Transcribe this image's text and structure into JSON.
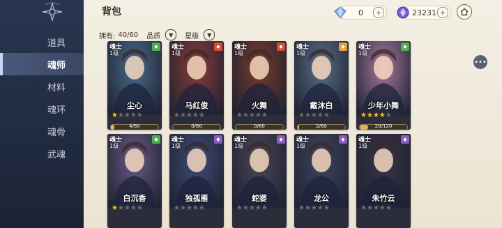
{
  "sidebar": {
    "items": [
      {
        "label": "道具",
        "active": false
      },
      {
        "label": "魂师",
        "active": true
      },
      {
        "label": "材料",
        "active": false
      },
      {
        "label": "魂环",
        "active": false
      },
      {
        "label": "魂骨",
        "active": false
      },
      {
        "label": "武魂",
        "active": false
      }
    ]
  },
  "header": {
    "title": "背包",
    "currency1": {
      "icon": "diamond-icon",
      "value": "0"
    },
    "currency2": {
      "icon": "purple-crystal-icon",
      "value": "23231"
    },
    "home_icon": "home-icon"
  },
  "filters": {
    "owned_label": "拥有:",
    "owned_value": "40/60",
    "quality_label": "品质",
    "star_label": "星级"
  },
  "chat_icon": "chat-bubble-icon",
  "cards": [
    {
      "type": "魂士",
      "level": "1级",
      "name": "尘心",
      "stars": 1,
      "max_stars": 5,
      "progress": "4/60",
      "progress_frac": 0.07,
      "element": "tree",
      "element_color": "#4caf50",
      "bg": "#4a6b8c"
    },
    {
      "type": "魂士",
      "level": "1级",
      "name": "马红俊",
      "stars": 0,
      "max_stars": 5,
      "progress": "0/60",
      "progress_frac": 0.0,
      "element": "fire",
      "element_color": "#d94a3a",
      "bg": "#8a3b3b"
    },
    {
      "type": "魂士",
      "level": "1级",
      "name": "火舞",
      "stars": 0,
      "max_stars": 5,
      "progress": "0/60",
      "progress_frac": 0.0,
      "element": "fire",
      "element_color": "#d94a3a",
      "bg": "#7a3a2c"
    },
    {
      "type": "魂士",
      "level": "1级",
      "name": "戴沐白",
      "stars": 0,
      "max_stars": 5,
      "progress": "2/60",
      "progress_frac": 0.03,
      "element": "light",
      "element_color": "#e2a23a",
      "bg": "#5a6f8a"
    },
    {
      "type": "魂士",
      "level": "1级",
      "name": "少年小舞",
      "stars": 4,
      "max_stars": 5,
      "progress": "20/120",
      "progress_frac": 0.17,
      "element": "tree",
      "element_color": "#4caf50",
      "bg": "#a87aa0"
    },
    {
      "type": "魂士",
      "level": "1级",
      "name": "白沉香",
      "stars": 1,
      "max_stars": 5,
      "progress": "",
      "progress_frac": 0,
      "element": "wind",
      "element_color": "#4caf50",
      "bg": "#6b5a8a"
    },
    {
      "type": "魂士",
      "level": "1级",
      "name": "独孤雁",
      "stars": 0,
      "max_stars": 5,
      "progress": "",
      "progress_frac": 0,
      "element": "dark",
      "element_color": "#8a5cc0",
      "bg": "#3f4c7a"
    },
    {
      "type": "魂士",
      "level": "1级",
      "name": "蛇婆",
      "stars": 0,
      "max_stars": 5,
      "progress": "",
      "progress_frac": 0,
      "element": "dark",
      "element_color": "#8a5cc0",
      "bg": "#4a4658"
    },
    {
      "type": "魂士",
      "level": "1级",
      "name": "龙公",
      "stars": 0,
      "max_stars": 5,
      "progress": "",
      "progress_frac": 0,
      "element": "dark",
      "element_color": "#8a5cc0",
      "bg": "#3f4560"
    },
    {
      "type": "魂士",
      "level": "1级",
      "name": "朱竹云",
      "stars": 0,
      "max_stars": 5,
      "progress": "",
      "progress_frac": 0,
      "element": "dark",
      "element_color": "#8a5cc0",
      "bg": "#3b3248"
    }
  ]
}
